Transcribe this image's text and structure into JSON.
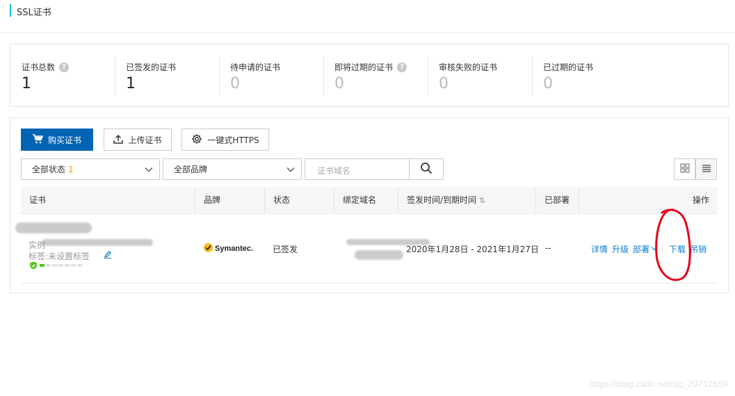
{
  "header": {
    "title": "SSL证书"
  },
  "stats": [
    {
      "label": "证书总数",
      "value": "1",
      "help": true
    },
    {
      "label": "已签发的证书",
      "value": "1",
      "help": false
    },
    {
      "label": "待申请的证书",
      "value": "0",
      "help": false
    },
    {
      "label": "即将过期的证书",
      "value": "0",
      "help": true
    },
    {
      "label": "审核失败的证书",
      "value": "0",
      "help": false
    },
    {
      "label": "已过期的证书",
      "value": "0",
      "help": false
    }
  ],
  "toolbar": {
    "buy_label": "购买证书",
    "upload_label": "上传证书",
    "https_label": "一键式HTTPS"
  },
  "filters": {
    "status_label": "全部状态",
    "status_count": "1",
    "brand_label": "全部品牌",
    "search_placeholder": "证书域名"
  },
  "table": {
    "headers": {
      "cert": "证书",
      "brand": "品牌",
      "status": "状态",
      "domain": "绑定域名",
      "time": "签发时间/到期时间",
      "deployed": "已部署",
      "actions": "操作"
    },
    "rows": [
      {
        "instance": "实例",
        "tags": "标签:未设置标签",
        "brand": "Symantec.",
        "status": "已签发",
        "time": "2020年1月28日 - 2021年1月27日",
        "deployed": "--",
        "actions": {
          "detail": "详情",
          "upgrade": "升级",
          "deploy": "部署",
          "download": "下载",
          "revoke": "吊销"
        }
      }
    ]
  },
  "watermark": "https://blog.csdn.net/qq_29712659",
  "colors": {
    "primary": "#0064b4",
    "link": "#0a7ecf",
    "accent_bar": "#00c1de",
    "count_orange": "#f39800",
    "annotation_red": "#e3001b"
  }
}
